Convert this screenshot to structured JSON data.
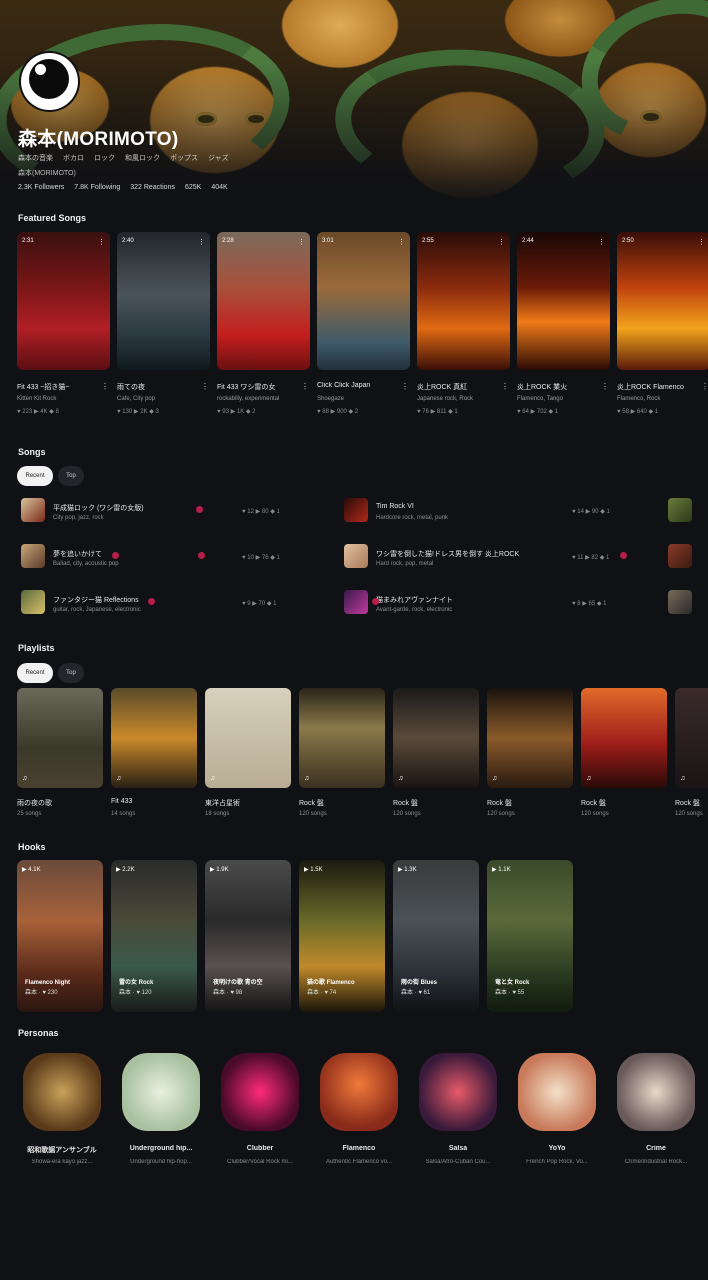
{
  "profile": {
    "name": "森本(MORIMOTO)",
    "tags": [
      "森本の音楽",
      "ボカロ",
      "ロック",
      "和風ロック",
      "ポップス",
      "ジャズ"
    ],
    "subname": "森本(MORIMOTO)",
    "stats": [
      "2.3K Followers",
      "7.8K Following",
      "322 Reactions",
      "625K",
      "404K"
    ]
  },
  "featured": {
    "title": "Featured Songs",
    "cards": [
      {
        "badge": "2:31",
        "title": "Fit 433 ~招き猫~",
        "sub": "Kitten Kit Rock",
        "meta": "♥ 223 ▶ 4K ◆ 8"
      },
      {
        "badge": "2:40",
        "title": "雨ての夜",
        "sub": "Cafe, City pop",
        "meta": "♥ 130 ▶ 2K ◆ 3"
      },
      {
        "badge": "2:28",
        "title": "Fit 433 ワシ雷の女",
        "sub": "rockabilly, experimental",
        "meta": "♥ 93 ▶ 1K ◆ 2"
      },
      {
        "badge": "3:01",
        "title": "Click Click Japan",
        "sub": "Shoegaze",
        "meta": "♥ 88 ▶ 900 ◆ 2"
      },
      {
        "badge": "2:55",
        "title": "炎上ROCK 真紅",
        "sub": "Japanese rock, Rock",
        "meta": "♥ 76 ▶ 811 ◆ 1"
      },
      {
        "badge": "2:44",
        "title": "炎上ROCK 業火",
        "sub": "Flamenco, Tango",
        "meta": "♥ 64 ▶ 702 ◆ 1"
      },
      {
        "badge": "2:50",
        "title": "炎上ROCK Flamenco",
        "sub": "Flamenco, Rock",
        "meta": "♥ 58 ▶ 640 ◆ 1"
      }
    ]
  },
  "songs": {
    "title": "Songs",
    "filters": [
      "Recent",
      "Top"
    ],
    "items": [
      {
        "title": "平成猫ロック (ワシ雷の女版)",
        "sub": "City pop, jazz, rock",
        "meta": "♥ 12 ▶ 80 ◆ 1"
      },
      {
        "title": "夢を追いかけて",
        "sub": "Ballad, city, acoustic pop",
        "meta": "♥ 10 ▶ 76 ◆ 1"
      },
      {
        "title": "ファンタジー猫 Reflections",
        "sub": "guitar, rock, Japanese, electronic",
        "meta": "♥ 9 ▶ 70 ◆ 1"
      },
      {
        "title": "Tim Rock VI",
        "sub": "Hardcore rock, metal, punk",
        "meta": "♥ 14 ▶ 90 ◆ 1"
      },
      {
        "title": "ワシ雷を倒した猫!ドレス男を倒す 炎上ROCK",
        "sub": "Hard rock, pop, metal",
        "meta": "♥ 11 ▶ 82 ◆ 1"
      },
      {
        "title": "猫まみれアヴァンナイト",
        "sub": "Avant-garde, rock, electronic",
        "meta": "♥ 8 ▶ 65 ◆ 1"
      }
    ]
  },
  "playlists": {
    "title": "Playlists",
    "filters": [
      "Recent",
      "Top"
    ],
    "items": [
      {
        "title": "雨の夜の歌",
        "sub": "25 songs"
      },
      {
        "title": "Fit 433",
        "sub": "14 songs"
      },
      {
        "title": "東洋占星術",
        "sub": "18 songs"
      },
      {
        "title": "Rock 盤",
        "sub": "120 songs"
      },
      {
        "title": "Rock 盤",
        "sub": "120 songs"
      },
      {
        "title": "Rock 盤",
        "sub": "120 songs"
      },
      {
        "title": "Rock 盤",
        "sub": "120 songs"
      },
      {
        "title": "Rock 盤",
        "sub": "120 songs"
      }
    ]
  },
  "hooks": {
    "title": "Hooks",
    "items": [
      {
        "top": "▶ 4.1K",
        "cap": "Flamenco Night",
        "cap2": "森本 · ♥ 230"
      },
      {
        "top": "▶ 2.2K",
        "cap": "雷の女 Rock",
        "cap2": "森本 · ♥ 120"
      },
      {
        "top": "▶ 1.9K",
        "cap": "夜明けの歌 青の空",
        "cap2": "森本 · ♥ 98"
      },
      {
        "top": "▶ 1.5K",
        "cap": "猫の歌 Flamenco",
        "cap2": "森本 · ♥ 74"
      },
      {
        "top": "▶ 1.3K",
        "cap": "雨の街 Blues",
        "cap2": "森本 · ♥ 61"
      },
      {
        "top": "▶ 1.1K",
        "cap": "竜と女 Rock",
        "cap2": "森本 · ♥ 55"
      }
    ]
  },
  "personas": {
    "title": "Personas",
    "items": [
      {
        "name": "昭和歌謡アンサンブル",
        "desc": "Showa-era kayo jazz..."
      },
      {
        "name": "Underground hip...",
        "desc": "Underground hip-hop..."
      },
      {
        "name": "Clubber",
        "desc": "Clubber/Vocal Rock mi..."
      },
      {
        "name": "Flamenco",
        "desc": "Authentic Flamenco vo..."
      },
      {
        "name": "Salsa",
        "desc": "Salsa/Afro-Cuban Cou..."
      },
      {
        "name": "YoYo",
        "desc": "French Pop Rock, Vo..."
      },
      {
        "name": "Crime",
        "desc": "Crime/Industrial Rock..."
      }
    ]
  }
}
